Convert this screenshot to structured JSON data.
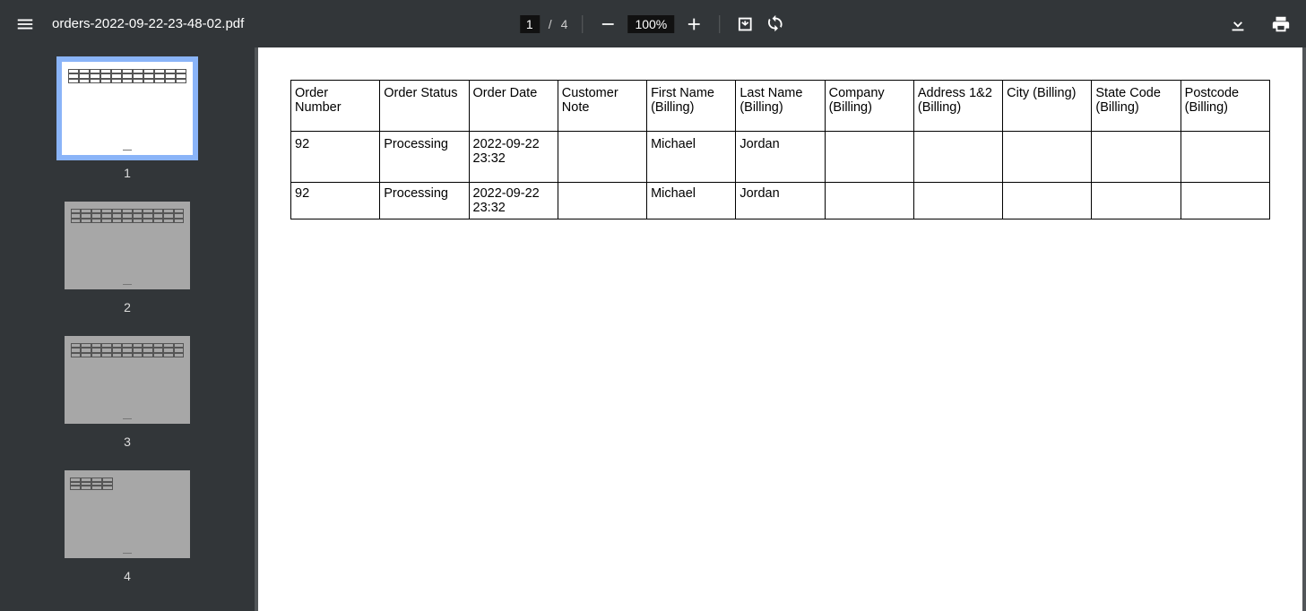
{
  "toolbar": {
    "filename": "orders-2022-09-22-23-48-02.pdf",
    "currentPage": "1",
    "pageSep": "/",
    "totalPages": "4",
    "zoom": "100%"
  },
  "sidebar": {
    "thumbs": [
      {
        "label": "1",
        "selected": true,
        "tableStyle": "big",
        "bg": "white"
      },
      {
        "label": "2",
        "selected": false,
        "tableStyle": "big",
        "bg": "gray"
      },
      {
        "label": "3",
        "selected": false,
        "tableStyle": "big",
        "bg": "gray"
      },
      {
        "label": "4",
        "selected": false,
        "tableStyle": "small",
        "bg": "gray"
      }
    ]
  },
  "table": {
    "headers": [
      "Order Number",
      "Order Status",
      "Order Date",
      "Customer Note",
      "First Name (Billing)",
      "Last Name (Billing)",
      "Company (Billing)",
      "Address 1&2 (Billing)",
      "City (Billing)",
      "State Code (Billing)",
      "Postcode (Billing)"
    ],
    "rows": [
      {
        "orderNumber": "92",
        "orderStatus": "Processing",
        "orderDate": "2022-09-22 23:32",
        "customerNote": "",
        "firstName": "Michael",
        "lastName": "Jordan",
        "company": "",
        "address": "",
        "city": "",
        "stateCode": "",
        "postcode": ""
      },
      {
        "orderNumber": "92",
        "orderStatus": "Processing",
        "orderDate": "2022-09-22 23:32",
        "customerNote": "",
        "firstName": "Michael",
        "lastName": "Jordan",
        "company": "",
        "address": "",
        "city": "",
        "stateCode": "",
        "postcode": ""
      }
    ]
  }
}
